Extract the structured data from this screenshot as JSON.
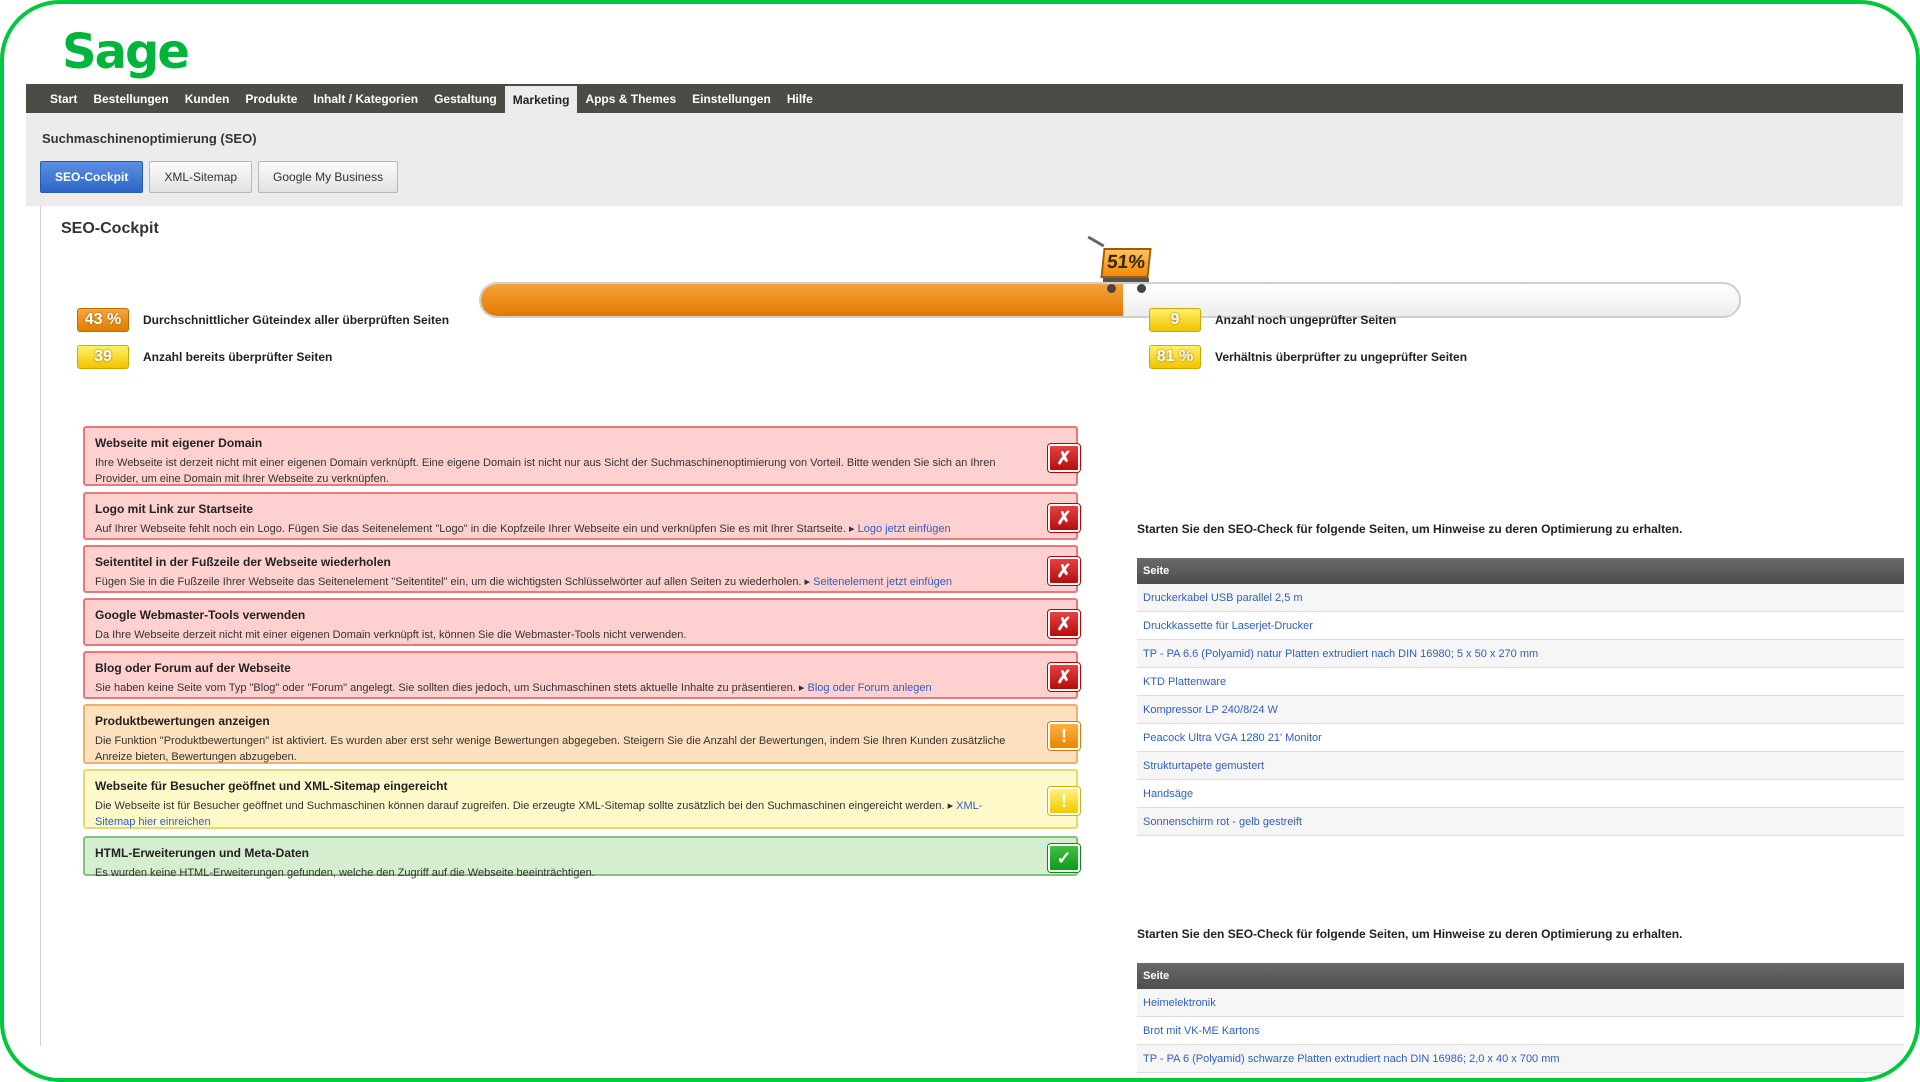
{
  "brand": {
    "logo_text": "Sage",
    "accent": "#00c83c"
  },
  "nav": {
    "items": [
      "Start",
      "Bestellungen",
      "Kunden",
      "Produkte",
      "Inhalt / Kategorien",
      "Gestaltung",
      "Marketing",
      "Apps & Themes",
      "Einstellungen",
      "Hilfe"
    ],
    "active": "Marketing"
  },
  "section_title": "Suchmaschinenoptimierung (SEO)",
  "tabs": [
    {
      "label": "SEO-Cockpit",
      "active": true
    },
    {
      "label": "XML-Sitemap",
      "active": false
    },
    {
      "label": "Google My Business",
      "active": false
    }
  ],
  "cockpit": {
    "title": "SEO-Cockpit",
    "progress_percent": 51,
    "progress_label": "51%"
  },
  "stats": {
    "quality": {
      "value": "43 %",
      "label": "Durchschnittlicher Güteindex aller überprüften Seiten"
    },
    "checked": {
      "value": "39",
      "label": "Anzahl bereits überprüfter Seiten"
    },
    "unchecked": {
      "value": "9",
      "label": "Anzahl noch ungeprüfter Seiten"
    },
    "ratio": {
      "value": "81 %",
      "label": "Verhältnis überprüfter zu ungeprüfter Seiten"
    }
  },
  "checks": [
    {
      "status": "error",
      "icon": "x-icon",
      "title": "Webseite mit eigener Domain",
      "text": "Ihre Webseite ist derzeit nicht mit einer eigenen Domain verknüpft. Eine eigene Domain ist nicht nur aus Sicht der Suchmaschinenoptimierung von Vorteil. Bitte wenden Sie sich an Ihren Provider, um eine Domain mit Ihrer Webseite zu verknüpfen.",
      "link": ""
    },
    {
      "status": "error",
      "icon": "x-icon",
      "title": "Logo mit Link zur Startseite",
      "text": "Auf Ihrer Webseite fehlt noch ein Logo. Fügen Sie das Seitenelement \"Logo\" in die Kopfzeile Ihrer Webseite ein und verknüpfen Sie es mit Ihrer Startseite. ▸ ",
      "link": "Logo jetzt einfügen"
    },
    {
      "status": "error",
      "icon": "x-icon",
      "title": "Seitentitel in der Fußzeile der Webseite wiederholen",
      "text": "Fügen Sie in die Fußzeile Ihrer Webseite das Seitenelement \"Seitentitel\" ein, um die wichtigsten Schlüsselwörter auf allen Seiten zu wiederholen. ▸ ",
      "link": "Seitenelement jetzt einfügen"
    },
    {
      "status": "error",
      "icon": "x-icon",
      "title": "Google Webmaster-Tools verwenden",
      "text": "Da Ihre Webseite derzeit nicht mit einer eigenen Domain verknüpft ist, können Sie die Webmaster-Tools nicht verwenden.",
      "link": ""
    },
    {
      "status": "error",
      "icon": "x-icon",
      "title": "Blog oder Forum auf der Webseite",
      "text": "Sie haben keine Seite vom Typ \"Blog\" oder \"Forum\" angelegt. Sie sollten dies jedoch, um Suchmaschinen stets aktuelle Inhalte zu präsentieren. ▸ ",
      "link": "Blog oder Forum anlegen"
    },
    {
      "status": "warning",
      "icon": "exclamation-icon",
      "title": "Produktbewertungen anzeigen",
      "text": "Die Funktion \"Produktbewertungen\" ist aktiviert. Es wurden aber erst sehr wenige Bewertungen abgegeben. Steigern Sie die Anzahl der Bewertungen, indem Sie Ihren Kunden zusätzliche Anreize bieten, Bewertungen abzugeben.",
      "link": ""
    },
    {
      "status": "notice",
      "icon": "exclamation-icon",
      "title": "Webseite für Besucher geöffnet und XML-Sitemap eingereicht",
      "text": "Die Webseite ist für Besucher geöffnet und Suchmaschinen können darauf zugreifen. Die erzeugte XML-Sitemap sollte zusätzlich bei den Suchmaschinen eingereicht werden. ▸ ",
      "link": "XML-Sitemap hier einreichen"
    },
    {
      "status": "ok",
      "icon": "check-icon",
      "title": "HTML-Erweiterungen und Meta-Daten",
      "text": "Es wurden keine HTML-Erweiterungen gefunden, welche den Zugriff auf die Webseite beeinträchtigen.",
      "link": ""
    }
  ],
  "status_glyphs": {
    "x-icon": "✗",
    "exclamation-icon": "!",
    "check-icon": "✓"
  },
  "side_lists": [
    {
      "heading": "Starten Sie den SEO-Check für folgende Seiten, um Hinweise zu deren Optimierung zu erhalten.",
      "column": "Seite",
      "rows": [
        "Druckerkabel USB parallel 2,5 m",
        "Druckkassette für Laserjet-Drucker",
        "TP - PA 6.6 (Polyamid) natur Platten extrudiert nach DIN 16980; 5 x 50 x 270 mm",
        "KTD Plattenware",
        "Kompressor LP 240/8/24 W",
        "Peacock Ultra VGA 1280 21' Monitor",
        "Strukturtapete gemustert",
        "Handsäge",
        "Sonnenschirm rot - gelb gestreift"
      ]
    },
    {
      "heading": "Starten Sie den SEO-Check für folgende Seiten, um Hinweise zu deren Optimierung zu erhalten.",
      "column": "Seite",
      "rows": [
        "Heimelektronik",
        "Brot mit VK-ME Kartons",
        "TP - PA 6 (Polyamid) schwarze Platten extrudiert nach DIN 16986; 2,0 x 40 x 700 mm"
      ]
    }
  ]
}
